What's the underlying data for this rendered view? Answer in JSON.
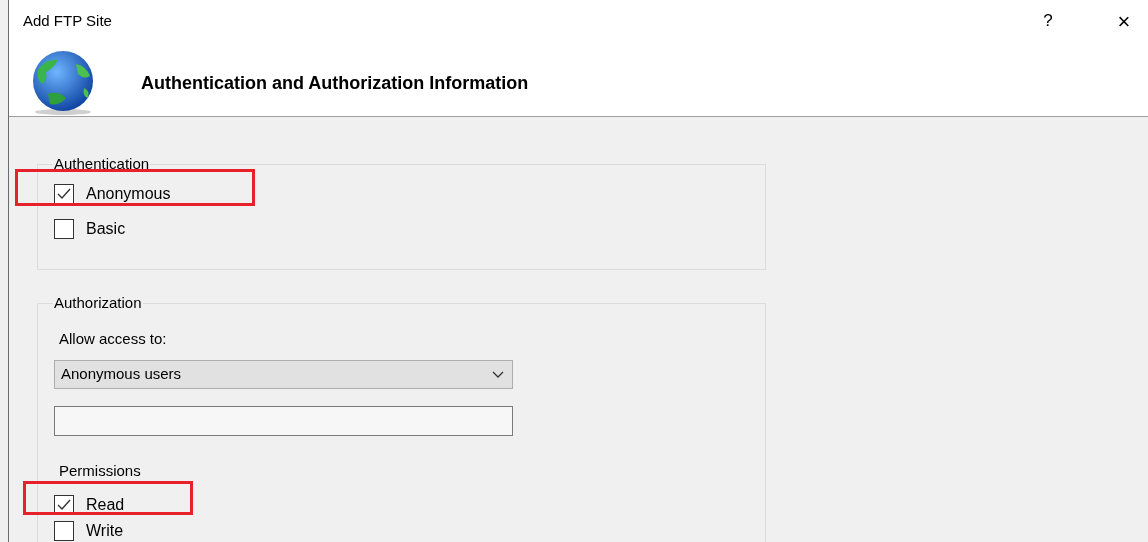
{
  "window": {
    "title": "Add FTP Site",
    "help": "?",
    "close": "×"
  },
  "header": {
    "title": "Authentication and Authorization Information"
  },
  "authentication": {
    "legend": "Authentication",
    "options": [
      {
        "label": "Anonymous",
        "checked": true,
        "highlighted": true
      },
      {
        "label": "Basic",
        "checked": false,
        "highlighted": false
      }
    ]
  },
  "authorization": {
    "legend": "Authorization",
    "allow_access_label": "Allow access to:",
    "allow_access_value": "Anonymous users",
    "permissions_label": "Permissions",
    "permissions": [
      {
        "label": "Read",
        "checked": true,
        "highlighted": true
      },
      {
        "label": "Write",
        "checked": false,
        "highlighted": false
      }
    ]
  }
}
